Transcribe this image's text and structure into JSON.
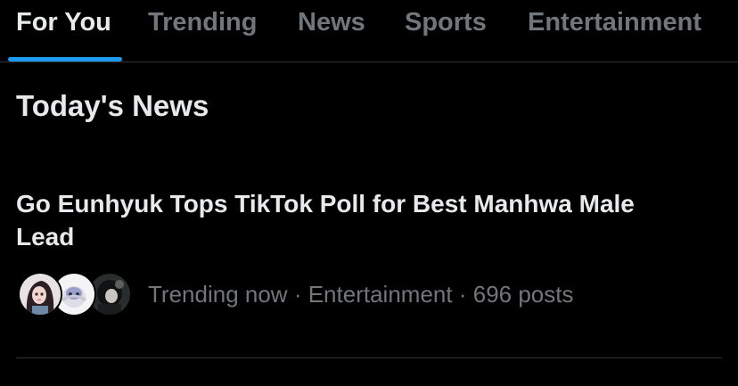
{
  "tabs": [
    {
      "label": "For You",
      "active": true
    },
    {
      "label": "Trending",
      "active": false
    },
    {
      "label": "News",
      "active": false
    },
    {
      "label": "Sports",
      "active": false
    },
    {
      "label": "Entertainment",
      "active": false
    }
  ],
  "section": {
    "title": "Today's News"
  },
  "news_item": {
    "headline": "Go Eunhyuk Tops TikTok Poll for Best Manhwa Male Lead",
    "meta": {
      "status": "Trending now",
      "separator": "·",
      "category": "Entertainment",
      "posts": "696 posts"
    },
    "avatars": [
      "anime-girl-avatar",
      "anime-character-white-avatar",
      "dark-haired-character-avatar"
    ]
  },
  "colors": {
    "background": "#000000",
    "text_primary": "#e7e9ea",
    "text_secondary": "#71767b",
    "accent": "#1d9bf0",
    "divider": "#2f3336"
  }
}
